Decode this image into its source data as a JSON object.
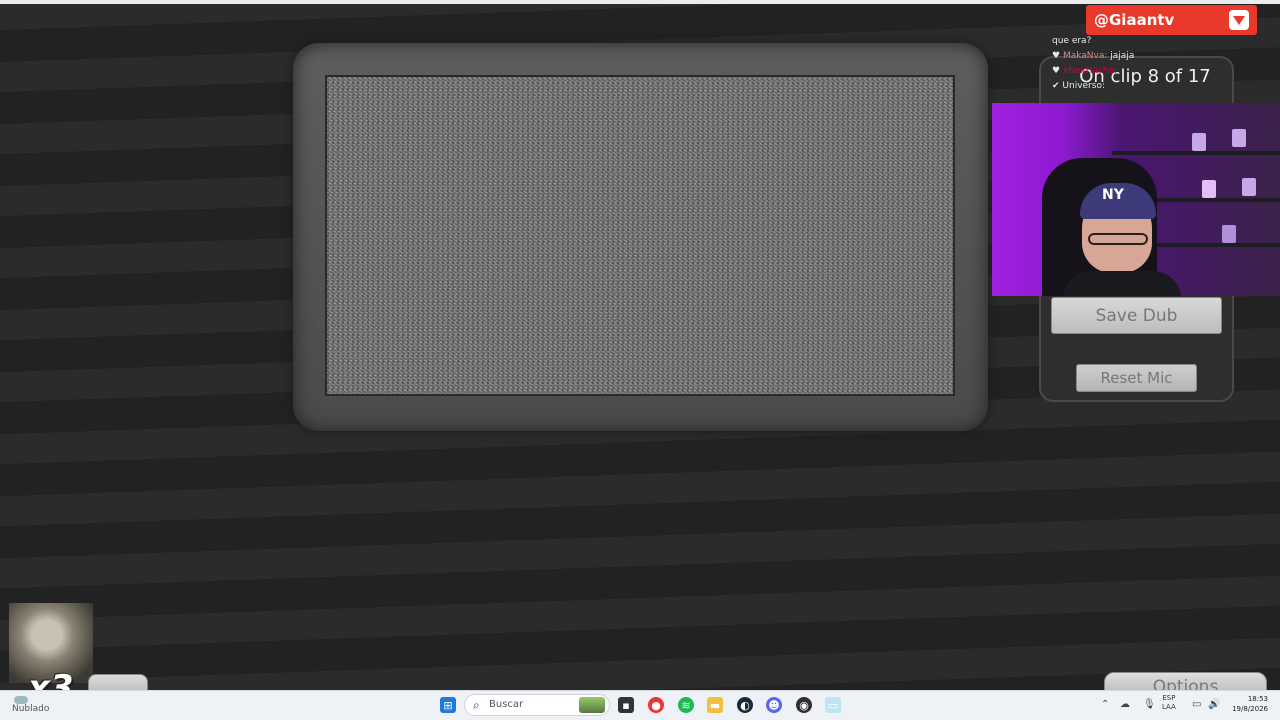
{
  "game": {
    "clip_counter": "On clip 8 of 17",
    "save_dub_label": "Save Dub",
    "reset_mic_label": "Reset Mic",
    "bottom_right_button_label": "Options"
  },
  "stream_overlay": {
    "handle": "@Giaantv",
    "chat": [
      {
        "user": "",
        "text": "que era?"
      },
      {
        "user": "MakaNva:",
        "text": "jajaja"
      },
      {
        "user": "xNexHache:",
        "text": ""
      },
      {
        "user": "Universo:",
        "text": ""
      }
    ],
    "cap_logo": "NY",
    "mini_cam_label": "x3"
  },
  "taskbar": {
    "weather_text": "Nublado",
    "search_placeholder": "Buscar",
    "language": "ESP",
    "keyboard": "LAA",
    "time": "18:53",
    "date": "19/8/2026",
    "icons": [
      "windows-start-icon",
      "search-icon",
      "task-view-icon",
      "chrome-icon",
      "spotify-icon",
      "file-explorer-icon",
      "steam-icon",
      "discord-icon",
      "obs-icon",
      "app-icon"
    ]
  },
  "colors": {
    "background": "#262626",
    "banner_red": "#e8392b",
    "webcam_purple": "#a020e0"
  }
}
